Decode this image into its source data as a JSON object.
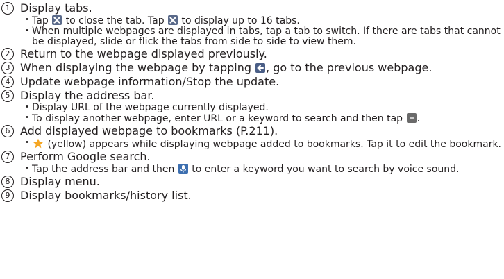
{
  "items": [
    {
      "num": "1",
      "text": "Display tabs.",
      "subs": [
        {
          "parts": [
            "Tap ",
            "{close-icon}",
            " to close the tab. Tap ",
            "{close-icon}",
            " to display up to 16 tabs."
          ]
        },
        {
          "parts": [
            "When multiple webpages are displayed in tabs, tap a tab to switch. If there are tabs that cannot be displayed, slide or flick the tabs from side to side to view them."
          ]
        }
      ]
    },
    {
      "num": "2",
      "text": "Return to the webpage displayed previously.",
      "subs": []
    },
    {
      "num": "3",
      "text_a": "When displaying the webpage by tapping ",
      "text_b": ", go to the previous webpage.",
      "subs": []
    },
    {
      "num": "4",
      "text": "Update webpage information/Stop the update.",
      "subs": []
    },
    {
      "num": "5",
      "text": "Display the address bar.",
      "subs": [
        {
          "parts": [
            "Display URL of the webpage currently displayed."
          ]
        },
        {
          "parts": [
            "To display another webpage, enter URL or a keyword to search and then tap ",
            "{go-icon}",
            "."
          ]
        }
      ]
    },
    {
      "num": "6",
      "text": "Add displayed webpage to bookmarks (P.211).",
      "subs": [
        {
          "parts": [
            "{star-icon}",
            " (yellow) appears while displaying webpage added to bookmarks. Tap it to edit the bookmark."
          ]
        }
      ]
    },
    {
      "num": "7",
      "text": "Perform Google search.",
      "subs": [
        {
          "parts": [
            "Tap the address bar and then ",
            "{mic-icon}",
            " to enter a keyword you want to search by voice sound."
          ]
        }
      ]
    },
    {
      "num": "8",
      "text": "Display menu.",
      "subs": []
    },
    {
      "num": "9",
      "text": "Display bookmarks/history list.",
      "subs": []
    }
  ],
  "bullet": "・",
  "colors": {
    "text": "#231f20",
    "icon_dark": "#5a6a8a",
    "star": "#f5a623",
    "mic": "#3d6fb0"
  }
}
